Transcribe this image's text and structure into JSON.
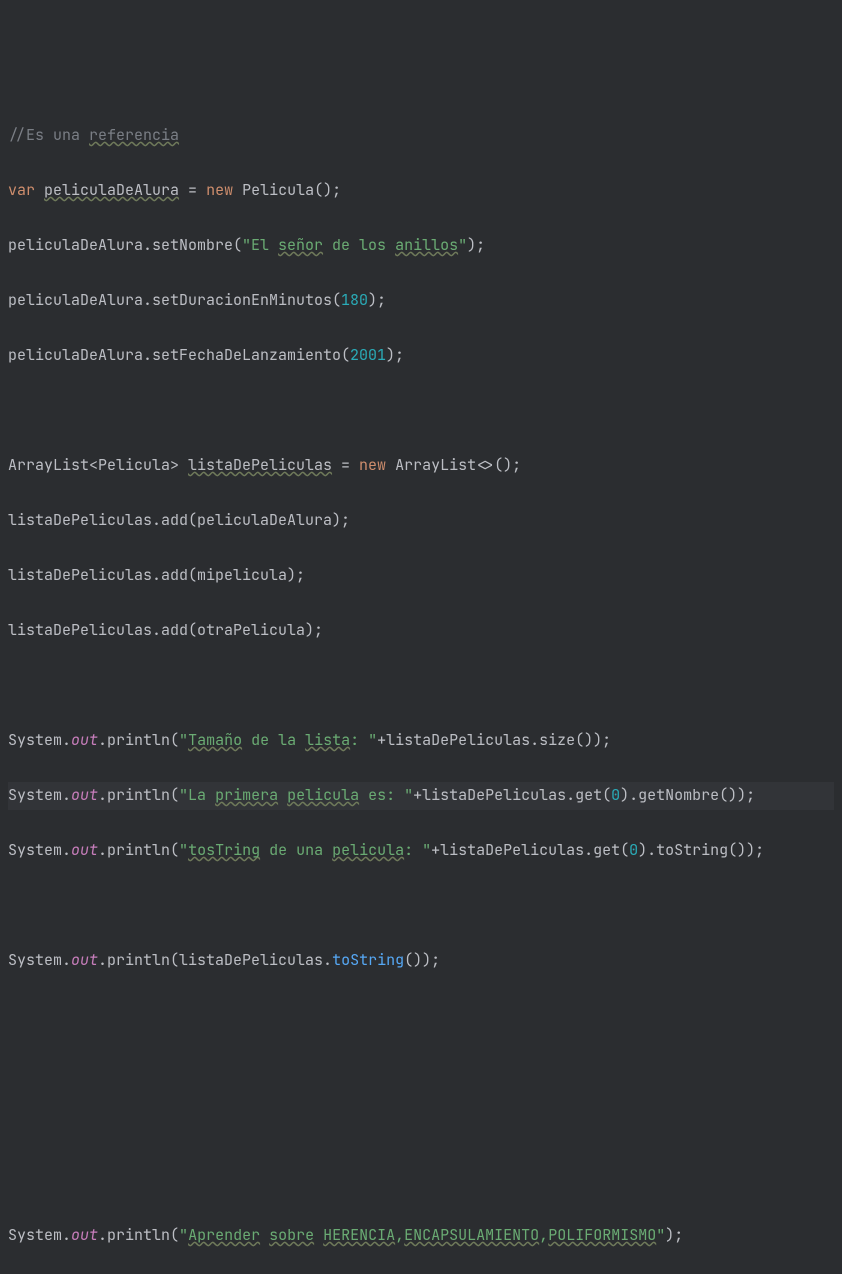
{
  "code": {
    "l1_comment_prefix": "//Es una ",
    "l1_comment_ref": "referencia",
    "l2_var": "var",
    "l2_name": "peliculaDeAlura",
    "l2_eq": " = ",
    "l2_new": "new",
    "l2_rest": " Pelicula();",
    "l3_pre": "peliculaDeAlura.setNombre(",
    "l3_s1": "\"El ",
    "l3_s2": "señor",
    "l3_s3": " de los ",
    "l3_s4": "anillos",
    "l3_s5": "\"",
    "l3_post": ");",
    "l4_pre": "peliculaDeAlura.setDuracionEnMinutos(",
    "l4_num": "180",
    "l4_post": ");",
    "l5_pre": "peliculaDeAlura.setFechaDeLanzamiento(",
    "l5_num": "2001",
    "l5_post": ");",
    "l7_a": "ArrayList<Pelicula> ",
    "l7_name": "listaDePeliculas",
    "l7_eq": " = ",
    "l7_new": "new",
    "l7_b": " ArrayList<>();",
    "l8": "listaDePeliculas.add(peliculaDeAlura);",
    "l9": "listaDePeliculas.add(mipelicula);",
    "l10": "listaDePeliculas.add(otraPelicula);",
    "sys": "System.",
    "out": "out",
    "println_open": ".println(",
    "close_paren_semi": ");",
    "l12_s1": "\"",
    "l12_s2": "Tamaño",
    "l12_s3": " de la ",
    "l12_s4": "lista",
    "l12_s5": ": \"",
    "l12_tail": "+listaDePeliculas.size());",
    "l13_s1": "\"La ",
    "l13_s2": "primera",
    "l13_s3": " ",
    "l13_s4": "pelicula",
    "l13_s5": " es: \"",
    "l13_tail_a": "+listaDePeliculas.get(",
    "l13_num": "0",
    "l13_tail_b": ").getNombre());",
    "l14_s1": "\"",
    "l14_s2": "tosTring",
    "l14_s3": " de una ",
    "l14_s4": "pelicula",
    "l14_s5": ": \"",
    "l14_tail_a": "+listaDePeliculas.get(",
    "l14_num": "0",
    "l14_tail_b": ").toString());",
    "l16_a": "listaDePeliculas.",
    "l16_m": "toString",
    "l16_b": "());",
    "l21_s1": "\"",
    "l21_s2": "Aprender",
    "l21_s3": " ",
    "l21_s4": "sobre",
    "l21_s5": " ",
    "l21_s6": "HERENCIA",
    "l21_s7": ",",
    "l21_s8": "ENCAPSULAMIENTO",
    "l21_s9": ",",
    "l21_s10": "POLIFORMISMO",
    "l21_s11": "\""
  }
}
